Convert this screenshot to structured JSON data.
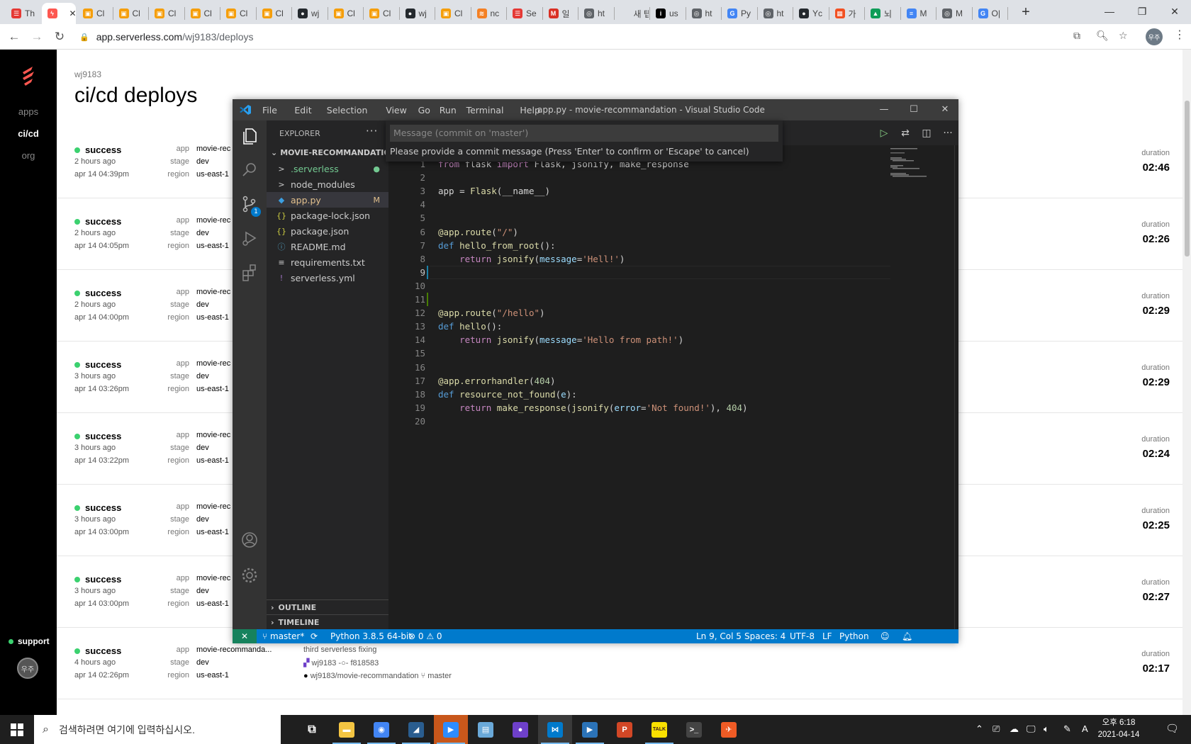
{
  "browser": {
    "tabs": [
      {
        "label": "Th",
        "color": "#e53935",
        "glyph": "☰"
      },
      {
        "label": "",
        "color": "#fd5750",
        "glyph": "ϟ",
        "active": true
      },
      {
        "label": "Cl",
        "color": "#f59e0b",
        "glyph": "▣"
      },
      {
        "label": "Cl",
        "color": "#f59e0b",
        "glyph": "▣"
      },
      {
        "label": "Cl",
        "color": "#f59e0b",
        "glyph": "▣"
      },
      {
        "label": "Cl",
        "color": "#f59e0b",
        "glyph": "▣"
      },
      {
        "label": "Cl",
        "color": "#f59e0b",
        "glyph": "▣"
      },
      {
        "label": "Cl",
        "color": "#f59e0b",
        "glyph": "▣"
      },
      {
        "label": "wj",
        "color": "#24292e",
        "glyph": "●"
      },
      {
        "label": "Cl",
        "color": "#f59e0b",
        "glyph": "▣"
      },
      {
        "label": "Cl",
        "color": "#f59e0b",
        "glyph": "▣"
      },
      {
        "label": "wj",
        "color": "#24292e",
        "glyph": "●"
      },
      {
        "label": "Cl",
        "color": "#f59e0b",
        "glyph": "▣"
      },
      {
        "label": "nc",
        "color": "#f48024",
        "glyph": "≋"
      },
      {
        "label": "Se",
        "color": "#e53935",
        "glyph": "☰"
      },
      {
        "label": "일",
        "color": "#d93025",
        "glyph": "M"
      },
      {
        "label": "ht",
        "color": "#5f6368",
        "glyph": "◎"
      },
      {
        "label": "새 탭",
        "color": "#dee1e6",
        "glyph": ""
      },
      {
        "label": "us",
        "color": "#000000",
        "glyph": "i"
      },
      {
        "label": "ht",
        "color": "#5f6368",
        "glyph": "◎"
      },
      {
        "label": "Py",
        "color": "#4285f4",
        "glyph": "G"
      },
      {
        "label": "ht",
        "color": "#5f6368",
        "glyph": "◎"
      },
      {
        "label": "Yc",
        "color": "#24292e",
        "glyph": "●"
      },
      {
        "label": "가",
        "color": "#f25022",
        "glyph": "▦"
      },
      {
        "label": "뇌",
        "color": "#0f9d58",
        "glyph": "▲"
      },
      {
        "label": "M",
        "color": "#4285f4",
        "glyph": "≡"
      },
      {
        "label": "M",
        "color": "#5f6368",
        "glyph": "◎"
      },
      {
        "label": "O|",
        "color": "#4285f4",
        "glyph": "G"
      }
    ],
    "new_tab": "+",
    "minimize": "—",
    "restore": "❐",
    "close": "✕",
    "back": "←",
    "forward": "→",
    "reload": "↻",
    "url_domain": "app.serverless.com",
    "url_path": "/wj9183/deploys",
    "profile": "우주",
    "menu": "⋮"
  },
  "sidebar": {
    "items": [
      {
        "label": "apps"
      },
      {
        "label": "ci/cd",
        "current": true
      },
      {
        "label": "org"
      }
    ],
    "support": "support",
    "avatar": "우주"
  },
  "page": {
    "breadcrumb": "wj9183",
    "title": "ci/cd deploys",
    "key_app": "app",
    "key_stage": "stage",
    "key_region": "region",
    "duration_label": "duration",
    "deploys": [
      {
        "status": "success",
        "ago": "2 hours ago",
        "date": "apr 14 04:39pm",
        "app": "movie-rec",
        "stage": "dev",
        "region": "us-east-1",
        "duration": "02:46"
      },
      {
        "status": "success",
        "ago": "2 hours ago",
        "date": "apr 14 04:05pm",
        "app": "movie-rec",
        "stage": "dev",
        "region": "us-east-1",
        "duration": "02:26"
      },
      {
        "status": "success",
        "ago": "2 hours ago",
        "date": "apr 14 04:00pm",
        "app": "movie-rec",
        "stage": "dev",
        "region": "us-east-1",
        "duration": "02:29"
      },
      {
        "status": "success",
        "ago": "3 hours ago",
        "date": "apr 14 03:26pm",
        "app": "movie-rec",
        "stage": "dev",
        "region": "us-east-1",
        "duration": "02:29"
      },
      {
        "status": "success",
        "ago": "3 hours ago",
        "date": "apr 14 03:22pm",
        "app": "movie-rec",
        "stage": "dev",
        "region": "us-east-1",
        "duration": "02:24"
      },
      {
        "status": "success",
        "ago": "3 hours ago",
        "date": "apr 14 03:00pm",
        "app": "movie-rec",
        "stage": "dev",
        "region": "us-east-1",
        "duration": "02:25"
      },
      {
        "status": "success",
        "ago": "3 hours ago",
        "date": "apr 14 03:00pm",
        "app": "movie-rec",
        "stage": "dev",
        "region": "us-east-1",
        "duration": "02:27"
      },
      {
        "status": "success",
        "ago": "4 hours ago",
        "date": "apr 14 02:26pm",
        "app": "movie-recommanda...",
        "stage": "dev",
        "region": "us-east-1",
        "duration": "02:17",
        "commit_msg": "third serverless fixing",
        "commit_author": "wj9183",
        "commit_sha": "f818583",
        "repo": "wj9183/movie-recommandation",
        "branch": "master"
      }
    ]
  },
  "vscode": {
    "menu": [
      "File",
      "Edit",
      "Selection",
      "View",
      "Go",
      "Run",
      "Terminal",
      "Help"
    ],
    "window_title": "app.py - movie-recommandation - Visual Studio Code",
    "explorer_title": "EXPLORER",
    "more": "···",
    "project": "MOVIE-RECOMMANDATION",
    "files": [
      {
        "name": ".serverless",
        "icon": ">",
        "color": "#73c991",
        "badge": "●",
        "badge_color": "#73c991"
      },
      {
        "name": "node_modules",
        "icon": ">",
        "color": "#cccccc",
        "badge": ""
      },
      {
        "name": "app.py",
        "icon": "◆",
        "icon_color": "#3c9fe2",
        "color": "#e2c08d",
        "badge": "M",
        "badge_color": "#e2c08d",
        "selected": true
      },
      {
        "name": "package-lock.json",
        "icon": "{}",
        "icon_color": "#cbcb41",
        "color": "#cccccc",
        "badge": ""
      },
      {
        "name": "package.json",
        "icon": "{}",
        "icon_color": "#cbcb41",
        "color": "#cccccc",
        "badge": ""
      },
      {
        "name": "README.md",
        "icon": "ⓘ",
        "icon_color": "#519aba",
        "color": "#cccccc",
        "badge": ""
      },
      {
        "name": "requirements.txt",
        "icon": "≡",
        "icon_color": "#cccccc",
        "color": "#cccccc",
        "badge": ""
      },
      {
        "name": "serverless.yml",
        "icon": "!",
        "icon_color": "#a074c4",
        "color": "#cccccc",
        "badge": ""
      }
    ],
    "outline": "OUTLINE",
    "timeline": "TIMELINE",
    "scm_badge": "1",
    "commit_placeholder": "Message (commit on 'master')",
    "commit_hint": "Please provide a commit message (Press 'Enter' to confirm or 'Escape' to cancel)",
    "code_lines": [
      [
        {
          "t": "from ",
          "c": "im"
        },
        {
          "t": "flask ",
          "c": ""
        },
        {
          "t": "import ",
          "c": "im"
        },
        {
          "t": "Flask, jsonify, make_response",
          "c": ""
        }
      ],
      [],
      [
        {
          "t": "app = ",
          "c": ""
        },
        {
          "t": "Flask",
          "c": "fn"
        },
        {
          "t": "(__name__)",
          "c": ""
        }
      ],
      [],
      [],
      [
        {
          "t": "@app.route",
          "c": "dec"
        },
        {
          "t": "(",
          "c": ""
        },
        {
          "t": "\"/\"",
          "c": "st2"
        },
        {
          "t": ")",
          "c": ""
        }
      ],
      [
        {
          "t": "def ",
          "c": "kw"
        },
        {
          "t": "hello_from_root",
          "c": "fn"
        },
        {
          "t": "():",
          "c": ""
        }
      ],
      [
        {
          "t": "    return ",
          "c": "im"
        },
        {
          "t": "jsonify",
          "c": "fn"
        },
        {
          "t": "(",
          "c": ""
        },
        {
          "t": "message",
          "c": "pm"
        },
        {
          "t": "=",
          "c": ""
        },
        {
          "t": "'Hell!'",
          "c": "st2"
        },
        {
          "t": ")",
          "c": ""
        }
      ],
      [],
      [],
      [],
      [
        {
          "t": "@app.route",
          "c": "dec"
        },
        {
          "t": "(",
          "c": ""
        },
        {
          "t": "\"/hello\"",
          "c": "st2"
        },
        {
          "t": ")",
          "c": ""
        }
      ],
      [
        {
          "t": "def ",
          "c": "kw"
        },
        {
          "t": "hello",
          "c": "fn"
        },
        {
          "t": "():",
          "c": ""
        }
      ],
      [
        {
          "t": "    return ",
          "c": "im"
        },
        {
          "t": "jsonify",
          "c": "fn"
        },
        {
          "t": "(",
          "c": ""
        },
        {
          "t": "message",
          "c": "pm"
        },
        {
          "t": "=",
          "c": ""
        },
        {
          "t": "'Hello from path!'",
          "c": "st2"
        },
        {
          "t": ")",
          "c": ""
        }
      ],
      [],
      [],
      [
        {
          "t": "@app.errorhandler",
          "c": "dec"
        },
        {
          "t": "(",
          "c": ""
        },
        {
          "t": "404",
          "c": "nu"
        },
        {
          "t": ")",
          "c": ""
        }
      ],
      [
        {
          "t": "def ",
          "c": "kw"
        },
        {
          "t": "resource_not_found",
          "c": "fn"
        },
        {
          "t": "(",
          "c": ""
        },
        {
          "t": "e",
          "c": "pm"
        },
        {
          "t": "):",
          "c": ""
        }
      ],
      [
        {
          "t": "    return ",
          "c": "im"
        },
        {
          "t": "make_response",
          "c": "fn"
        },
        {
          "t": "(",
          "c": ""
        },
        {
          "t": "jsonify",
          "c": "fn"
        },
        {
          "t": "(",
          "c": ""
        },
        {
          "t": "error",
          "c": "pm"
        },
        {
          "t": "=",
          "c": ""
        },
        {
          "t": "'Not found!'",
          "c": "st2"
        },
        {
          "t": "), ",
          "c": ""
        },
        {
          "t": "404",
          "c": "nu"
        },
        {
          "t": ")",
          "c": ""
        }
      ],
      []
    ],
    "current_line": 9,
    "status": {
      "remote": "✕",
      "branch": "master*",
      "sync": "⟳",
      "python": "Python 3.8.5 64-bit",
      "problems": "⊗ 0 ⚠ 0",
      "position": "Ln 9, Col 5",
      "spaces": "Spaces: 4",
      "encoding": "UTF-8",
      "eol": "LF",
      "language": "Python"
    }
  },
  "taskbar": {
    "search_placeholder": "검색하려면 여기에 입력하십시오.",
    "apps": [
      {
        "name": "task-view",
        "color": "#1f1f1f",
        "glyph": "⧉"
      },
      {
        "name": "file-explorer",
        "color": "#f4c542",
        "glyph": "▬",
        "open": true
      },
      {
        "name": "chrome",
        "color": "#4285f4",
        "glyph": "◉",
        "open": true
      },
      {
        "name": "mysql-workbench",
        "color": "#2a5d8f",
        "glyph": "◢",
        "open": true
      },
      {
        "name": "zoom",
        "color": "#2d8cff",
        "glyph": "▶",
        "open": true,
        "active_bg": "#c8571b"
      },
      {
        "name": "notepad",
        "color": "#6aa9d9",
        "glyph": "▤"
      },
      {
        "name": "github-desktop",
        "color": "#6e40c9",
        "glyph": "●"
      },
      {
        "name": "vscode",
        "color": "#007acc",
        "glyph": "⋈",
        "open": true,
        "active": true
      },
      {
        "name": "powershell",
        "color": "#2b73b8",
        "glyph": "▶",
        "open": true
      },
      {
        "name": "powerpoint",
        "color": "#d24726",
        "glyph": "P"
      },
      {
        "name": "kakaotalk",
        "color": "#f9e000",
        "glyph": "TALK",
        "open": true
      },
      {
        "name": "terminal",
        "color": "#444444",
        "glyph": ">_"
      },
      {
        "name": "postman",
        "color": "#ef5b25",
        "glyph": "✈"
      }
    ],
    "ime": "A",
    "time": "오후 6:18",
    "date": "2021-04-14"
  }
}
